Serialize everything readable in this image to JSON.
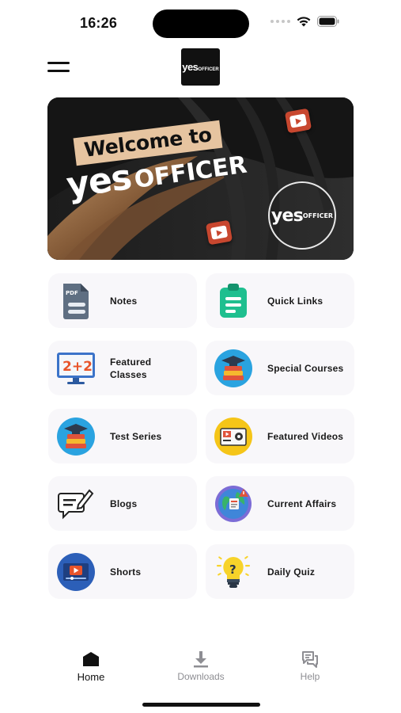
{
  "status_bar": {
    "time": "16:26"
  },
  "header": {
    "logo_yes": "yes",
    "logo_officer": "OFFICER"
  },
  "banner": {
    "welcome": "Welcome to",
    "brand_yes": "yes",
    "brand_officer": "OFFICER",
    "seal_yes": "yes",
    "seal_officer": "OFFICER"
  },
  "tiles": [
    {
      "label": "Notes",
      "icon": "pdf-notes-icon"
    },
    {
      "label": "Quick Links",
      "icon": "clipboard-icon"
    },
    {
      "label": "Featured\nClasses",
      "icon": "monitor-icon"
    },
    {
      "label": "Special Courses",
      "icon": "graduation-books-icon"
    },
    {
      "label": "Test Series",
      "icon": "graduation-books-icon"
    },
    {
      "label": "Featured Videos",
      "icon": "video-settings-icon"
    },
    {
      "label": "Blogs",
      "icon": "blog-edit-icon"
    },
    {
      "label": "Current Affairs",
      "icon": "globe-news-icon"
    },
    {
      "label": "Shorts",
      "icon": "video-player-icon"
    },
    {
      "label": "Daily Quiz",
      "icon": "lightbulb-question-icon"
    }
  ],
  "bottom_nav": [
    {
      "label": "Home",
      "active": true
    },
    {
      "label": "Downloads",
      "active": false
    },
    {
      "label": "Help",
      "active": false
    }
  ],
  "colors": {
    "tile_bg": "#f8f7fa",
    "banner_accent": "#e6c4a0",
    "nav_inactive": "#8e8e93"
  }
}
